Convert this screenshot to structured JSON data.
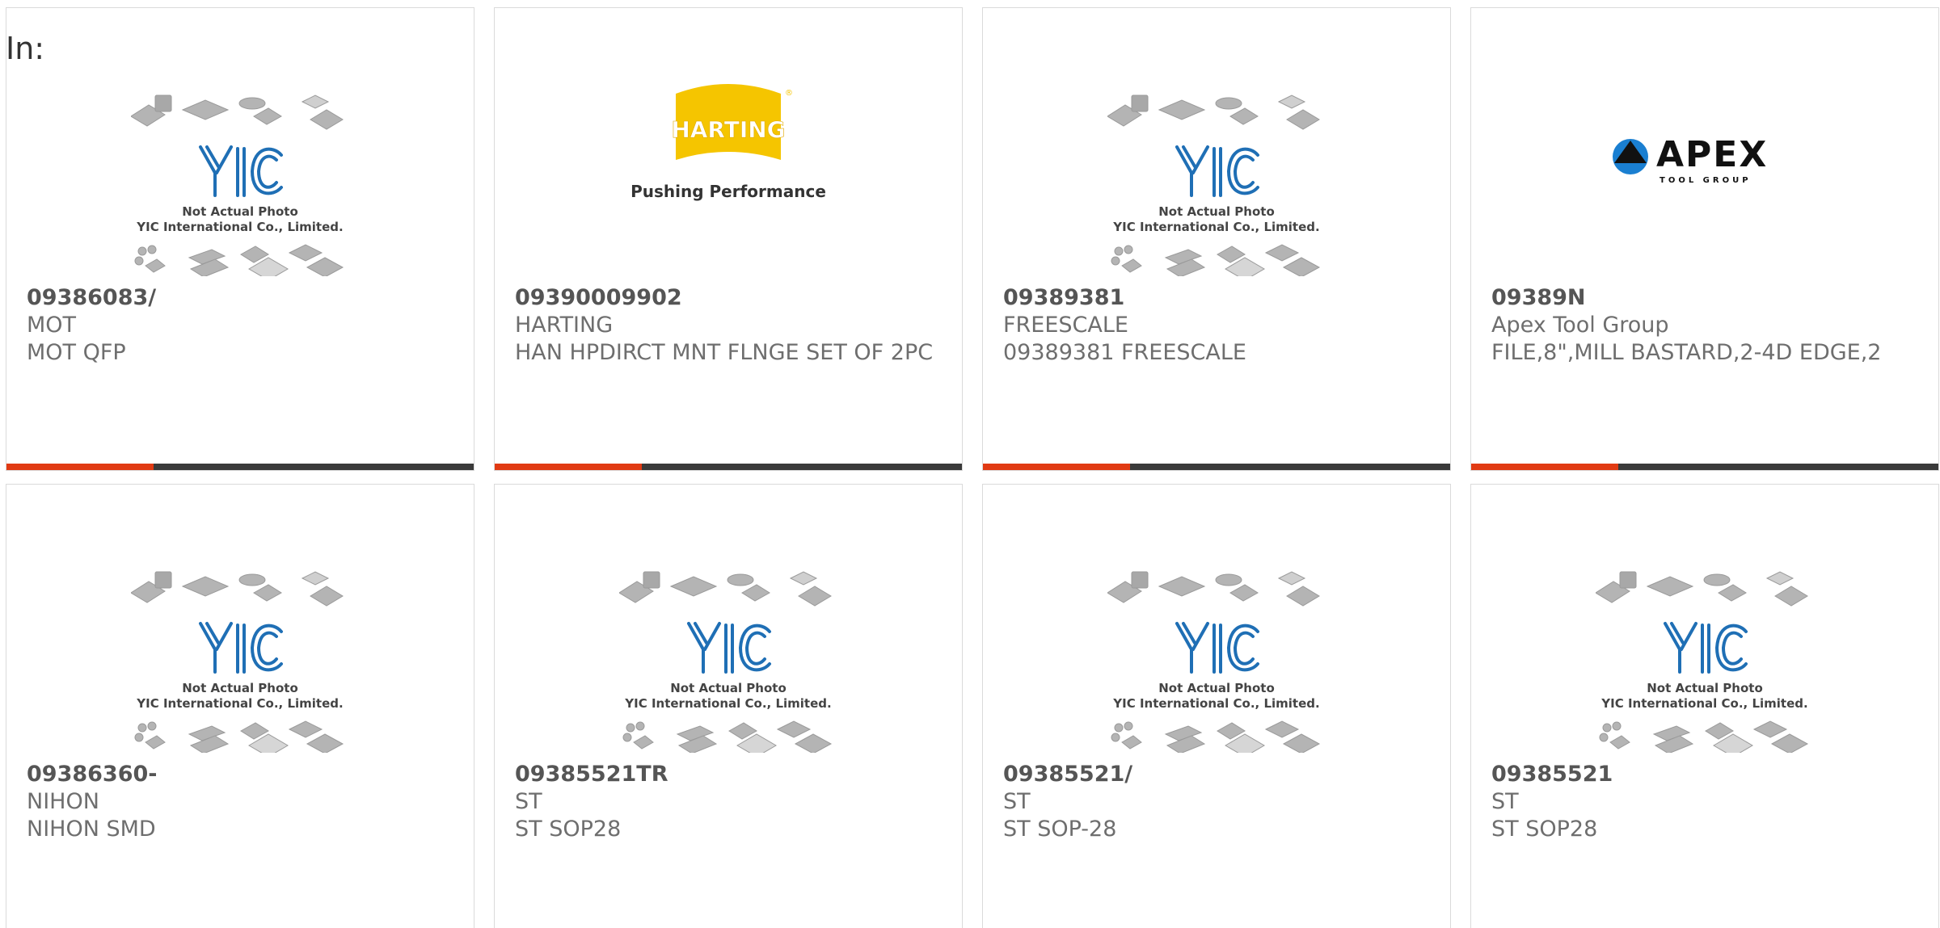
{
  "in_label": "In:",
  "placeholder_image": {
    "line1": "Not Actual Photo",
    "line2": "YIC International Co., Limited."
  },
  "harting_logo": {
    "brand": "HARTING",
    "tagline": "Pushing Performance"
  },
  "apex_logo": {
    "brand": "APEX",
    "tagline": "TOOL GROUP"
  },
  "products": [
    {
      "part": "09386083/",
      "maker": "MOT",
      "desc": "MOT QFP",
      "image": "yic-placeholder"
    },
    {
      "part": "09390009902",
      "maker": "HARTING",
      "desc": "HAN HPDIRCT MNT FLNGE SET OF 2PC",
      "image": "harting-logo"
    },
    {
      "part": "09389381",
      "maker": "FREESCALE",
      "desc": "09389381 FREESCALE",
      "image": "yic-placeholder"
    },
    {
      "part": "09389N",
      "maker": "Apex Tool Group",
      "desc": "FILE,8\",MILL BASTARD,2-4D EDGE,2",
      "image": "apex-logo"
    },
    {
      "part": "09386360-",
      "maker": "NIHON",
      "desc": "NIHON SMD",
      "image": "yic-placeholder"
    },
    {
      "part": "09385521TR",
      "maker": "ST",
      "desc": "ST SOP28",
      "image": "yic-placeholder"
    },
    {
      "part": "09385521/",
      "maker": "ST",
      "desc": "ST SOP-28",
      "image": "yic-placeholder"
    },
    {
      "part": "09385521",
      "maker": "ST",
      "desc": "ST SOP28",
      "image": "yic-placeholder"
    }
  ],
  "colors": {
    "accent": "#e13a13",
    "bar": "#3a3a3a",
    "yic_blue": "#1f6fb5",
    "harting_yellow": "#f5c500"
  }
}
